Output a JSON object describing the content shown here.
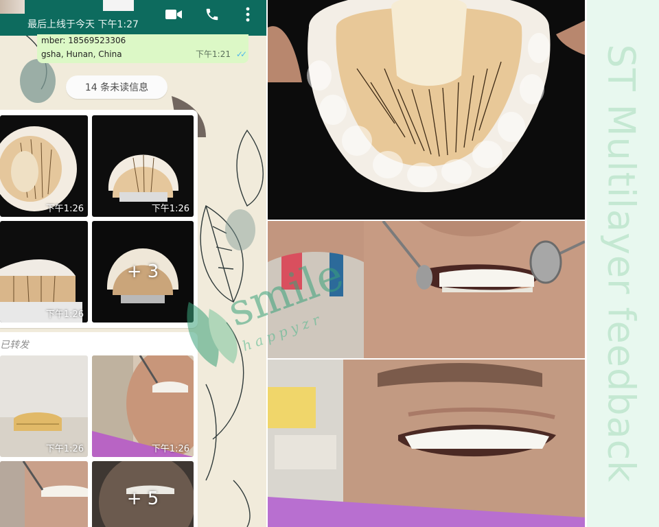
{
  "chat": {
    "last_seen": "最后上线于今天 下午1:27",
    "address_bubble": {
      "line1": "mber:  18569523306",
      "line2": "gsha, Hunan, China",
      "time": "下午1:21",
      "ticks": "✓✓"
    },
    "unread_label": "14 条未读信息",
    "album1": {
      "tiles": [
        {
          "time": "下午1:26"
        },
        {
          "time": "下午1:26"
        },
        {
          "time": "下午1:26"
        },
        {
          "more": "+ 3"
        }
      ]
    },
    "album2": {
      "forwarded": "已转发",
      "tiles": [
        {
          "time": "下午1:26"
        },
        {
          "time": "下午1:26"
        },
        {
          "time": ""
        },
        {
          "more": "+ 5"
        }
      ]
    }
  },
  "watermark": {
    "word": "smile",
    "sub": "happyzr"
  },
  "caption": "ST Multilayer feedback",
  "colors": {
    "appbar": "#0d6b5e",
    "bubble_out": "#dcf8c6",
    "caption_bg": "#e8f8ef",
    "caption_text": "#c4e8d2",
    "watermark": "#3aa27a"
  },
  "icons": [
    "video-call-icon",
    "phone-call-icon",
    "more-vert-icon",
    "double-check-icon"
  ]
}
